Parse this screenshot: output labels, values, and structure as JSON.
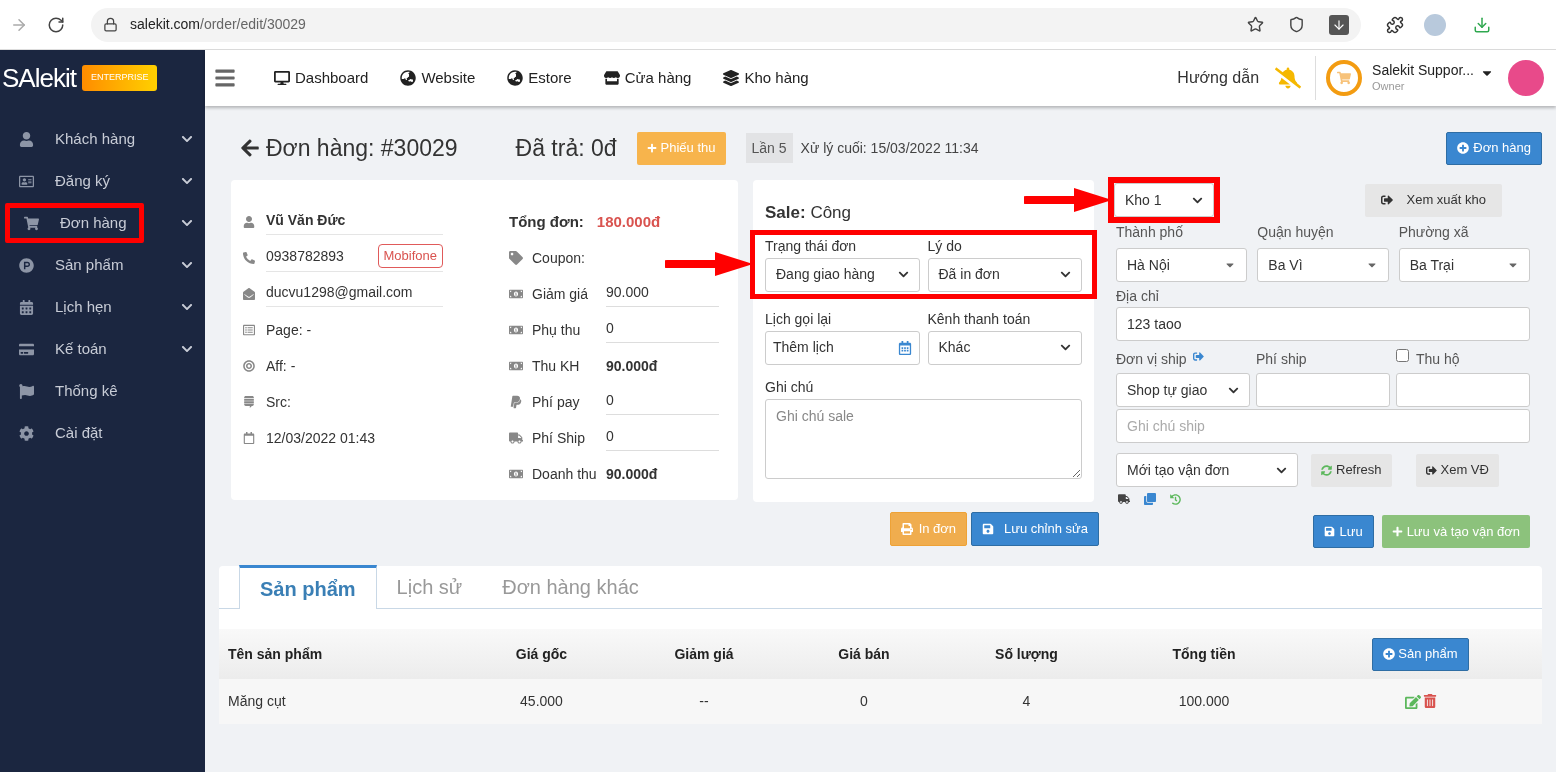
{
  "browser": {
    "host": "salekit.com",
    "path": "/order/edit/30029"
  },
  "sidebar": {
    "logo": "SAlekit",
    "badge": "ENTERPRISE",
    "items": [
      {
        "label": "Khách hàng",
        "has_submenu": true,
        "highlighted": false
      },
      {
        "label": "Đăng ký",
        "has_submenu": true,
        "highlighted": false
      },
      {
        "label": "Đơn hàng",
        "has_submenu": true,
        "highlighted": true
      },
      {
        "label": "Sản phẩm",
        "has_submenu": true,
        "highlighted": false
      },
      {
        "label": "Lịch hẹn",
        "has_submenu": true,
        "highlighted": false
      },
      {
        "label": "Kế toán",
        "has_submenu": true,
        "highlighted": false
      },
      {
        "label": "Thống kê",
        "has_submenu": false,
        "highlighted": false
      },
      {
        "label": "Cài đặt",
        "has_submenu": false,
        "highlighted": false
      }
    ]
  },
  "topnav": {
    "items": [
      {
        "label": "Dashboard"
      },
      {
        "label": "Website"
      },
      {
        "label": "Estore"
      },
      {
        "label": "Cửa hàng"
      },
      {
        "label": "Kho hàng"
      }
    ],
    "help": "Hướng dẫn",
    "user_name": "Salekit Suppor...",
    "user_role": "Owner"
  },
  "order": {
    "title": "Đơn hàng: #30029",
    "paid": "Đã trả: 0đ",
    "receipt_button": "Phiếu thu",
    "attempt": "Lần 5",
    "last_processed": "Xử lý cuối: 15/03/2022 11:34",
    "new_order_button": "Đơn hàng"
  },
  "customer": {
    "name": "Vũ Văn Đức",
    "phone": "0938782893",
    "carrier": "Mobifone",
    "email": "ducvu1298@gmail.com",
    "page": "Page: -",
    "aff": "Aff: -",
    "src": "Src:",
    "date": "12/03/2022 01:43"
  },
  "totals": {
    "label": "Tổng đơn:",
    "value": "180.000đ",
    "rows": [
      {
        "label": "Coupon:",
        "kind": "empty"
      },
      {
        "label": "Giảm giá",
        "kind": "input",
        "value": "90.000"
      },
      {
        "label": "Phụ thu",
        "kind": "input",
        "value": "0"
      },
      {
        "label": "Thu KH",
        "kind": "bold",
        "value": "90.000đ"
      },
      {
        "label": "Phí pay",
        "kind": "input",
        "value": "0"
      },
      {
        "label": "Phí Ship",
        "kind": "input",
        "value": "0"
      },
      {
        "label": "Doanh thu",
        "kind": "bold",
        "value": "90.000đ"
      }
    ]
  },
  "sale": {
    "label": "Sale:",
    "name": "Công",
    "status_highlighted": true,
    "status_label": "Trạng thái đơn",
    "status": "Đang giao hàng",
    "reason_label": "Lý do",
    "reason": "Đã in đơn",
    "callback_label": "Lịch gọi lại",
    "callback": "Thêm lịch",
    "payment_label": "Kênh thanh toán",
    "payment": "Khác",
    "note_label": "Ghi chú",
    "note_placeholder": "Ghi chú sale",
    "print_button": "In đơn",
    "save_button": "Lưu chỉnh sửa"
  },
  "shipping": {
    "warehouse": "Kho 1",
    "warehouse_highlighted": true,
    "export_button": "Xem xuất kho",
    "city_label": "Thành phố",
    "city": "Hà Nội",
    "district_label": "Quận huyện",
    "district": "Ba Vì",
    "ward_label": "Phường xã",
    "ward": "Ba Trại",
    "address_label": "Địa chỉ",
    "address": "123 taoo",
    "carrier_label": "Đơn vị ship",
    "fee_label": "Phí ship",
    "cod_label": "Thu hộ",
    "cod_checked": false,
    "carrier": "Shop tự giao",
    "note_placeholder": "Ghi chú ship",
    "waybill_status": "Mới tạo vận đơn",
    "refresh_button": "Refresh",
    "view_button": "Xem VĐ",
    "save_button": "Lưu",
    "save_create_button": "Lưu và tạo vận đơn"
  },
  "tabs": [
    {
      "label": "Sản phẩm",
      "selected": true
    },
    {
      "label": "Lịch sử",
      "selected": false
    },
    {
      "label": "Đơn hàng khác",
      "selected": false
    }
  ],
  "table": {
    "columns": [
      "Tên sản phẩm",
      "Giá gốc",
      "Giảm giá",
      "Giá bán",
      "Số lượng",
      "Tổng tiền"
    ],
    "add_button": "Sản phẩm",
    "rows": [
      {
        "cells": [
          "Măng cụt",
          "45.000",
          "--",
          "0",
          "4",
          "100.000"
        ]
      }
    ]
  }
}
